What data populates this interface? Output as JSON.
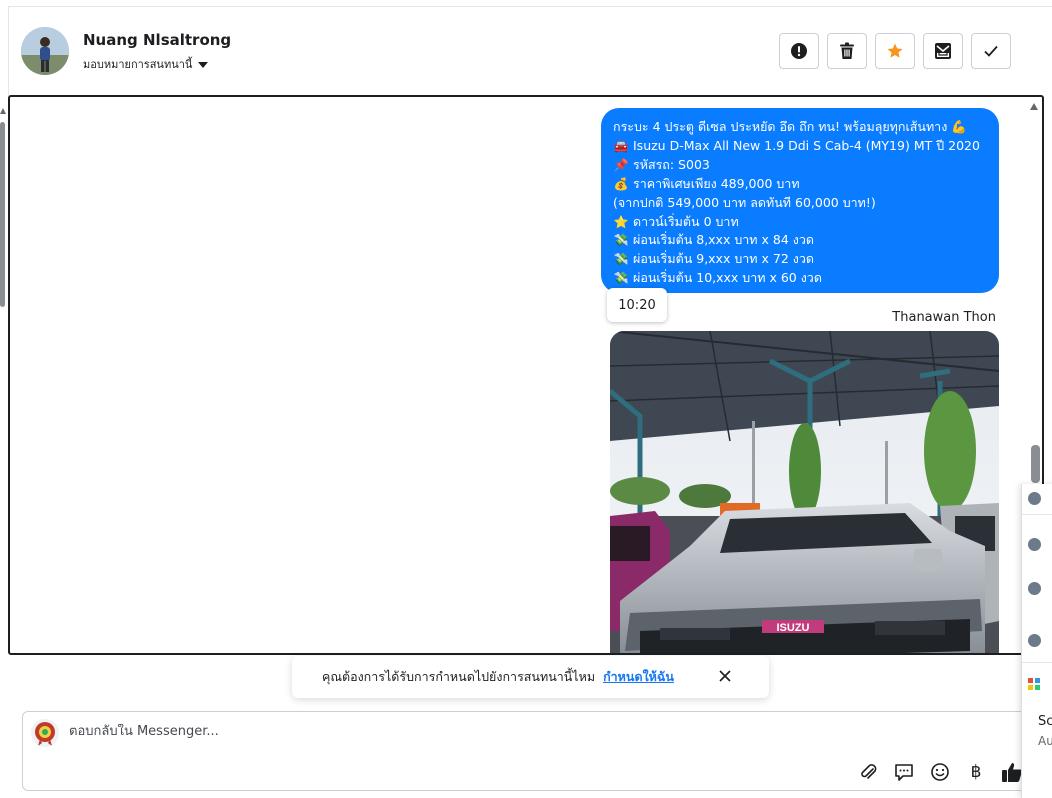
{
  "contact": {
    "name": "Nuang Nlsaltrong",
    "assign_label": "มอบหมายการสนทนานี้"
  },
  "toolbar": {
    "icons": [
      "alert-icon",
      "trash-icon",
      "star-icon",
      "inbox-icon",
      "check-icon"
    ],
    "colors": {
      "star": "#f7931e"
    }
  },
  "message": {
    "lines": [
      {
        "icon": "",
        "text": "กระบะ 4 ประตู ดีเซล ประหยัด อึด ถึก ทน! พร้อมลุยทุกเส้นทาง",
        "trail": "💪"
      },
      {
        "icon": "🚘",
        "text": "Isuzu D-Max All New 1.9 Ddi S Cab-4 (MY19) MT ปี 2020"
      },
      {
        "icon": "📌",
        "text": "รหัสรถ: S003"
      },
      {
        "icon": "💰",
        "text": "ราคาพิเศษเพียง 489,000 บาท"
      },
      {
        "icon": "",
        "text": "(จากปกติ 549,000 บาท ลดทันที 60,000 บาท!)"
      },
      {
        "icon": "⭐",
        "text": "ดาวน์เริ่มต้น 0 บาท"
      },
      {
        "icon": "💸",
        "text": "ผ่อนเริ่มต้น 8,xxx บาท x 84 งวด"
      },
      {
        "icon": "💸",
        "text": "ผ่อนเริ่มต้น 9,xxx บาท x 72 งวด"
      },
      {
        "icon": "💸",
        "text": "ผ่อนเริ่มต้น 10,xxx บาท x 60 งวด"
      }
    ],
    "time": "10:20",
    "bubble_color": "#0a7cff"
  },
  "photo": {
    "sender": "Thanawan Thon",
    "plate_brand": "ISUZU"
  },
  "assign_toast": {
    "text": "คุณต้องการได้รับการกำหนดไปยังการสนทนานี้ไหม",
    "link": "กำหนดให้ฉัน"
  },
  "composer": {
    "placeholder": "ตอบกลับใน Messenger...",
    "tools": [
      "paperclip-icon",
      "chat-bubble-icon",
      "emoji-icon",
      "baht-icon",
      "thumbs-up-icon"
    ],
    "baht_symbol": "฿"
  },
  "side_panel": {
    "text_1": "Sc",
    "text_2": "Au"
  }
}
